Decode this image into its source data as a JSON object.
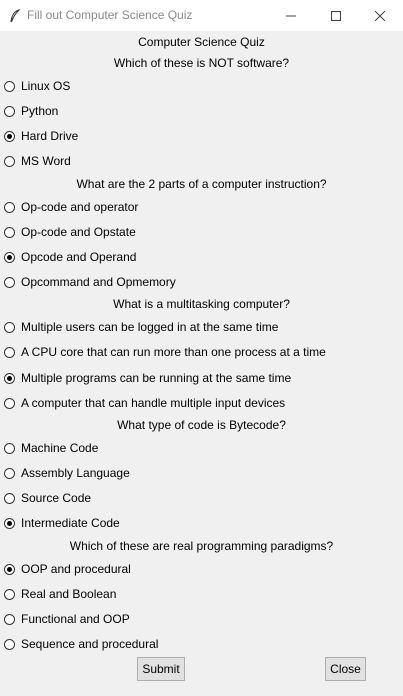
{
  "window": {
    "title": "Fill out Computer Science Quiz"
  },
  "quiz": {
    "heading": "Computer Science Quiz",
    "questions": [
      {
        "text": "Which of these is NOT software?",
        "options": [
          "Linux OS",
          "Python",
          "Hard Drive",
          "MS Word"
        ],
        "selected": 2
      },
      {
        "text": "What are the 2 parts of a computer instruction?",
        "options": [
          "Op-code and operator",
          "Op-code and Opstate",
          "Opcode and Operand",
          "Opcommand and Opmemory"
        ],
        "selected": 2
      },
      {
        "text": "What is a multitasking computer?",
        "options": [
          "Multiple users can be logged in at the same time",
          "A CPU core that can run more than one process at a time",
          "Multiple programs can be running at the same time",
          "A computer that can handle multiple input devices"
        ],
        "selected": 2
      },
      {
        "text": "What type of code is Bytecode?",
        "options": [
          "Machine Code",
          "Assembly Language",
          "Source Code",
          "Intermediate Code"
        ],
        "selected": 3
      },
      {
        "text": "Which of these are real programming paradigms?",
        "options": [
          "OOP and procedural",
          "Real and Boolean",
          "Functional and OOP",
          "Sequence and procedural"
        ],
        "selected": 0
      }
    ]
  },
  "buttons": {
    "submit_label": "Submit",
    "close_label": "Close"
  },
  "icons": {
    "app": "feather-icon",
    "minimize": "minimize-icon",
    "maximize": "maximize-icon",
    "close": "close-icon"
  }
}
